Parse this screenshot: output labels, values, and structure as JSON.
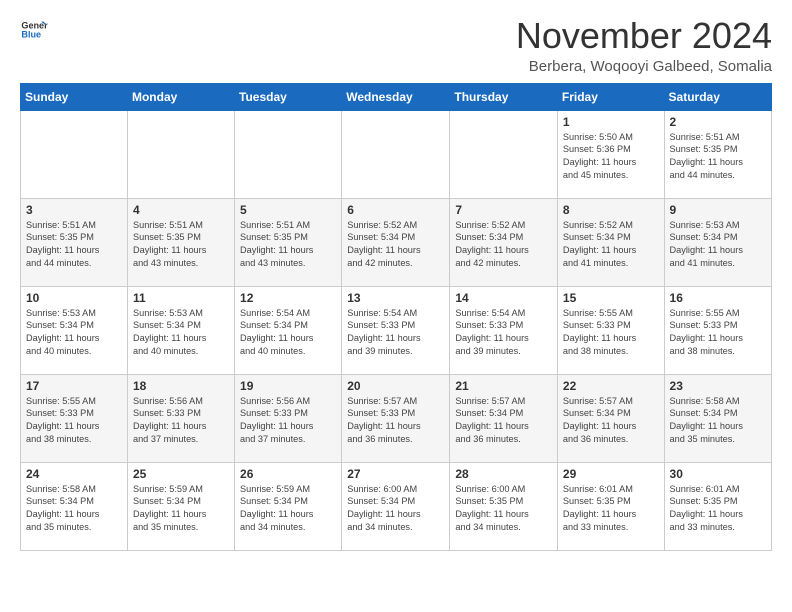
{
  "header": {
    "logo_line1": "General",
    "logo_line2": "Blue",
    "month_title": "November 2024",
    "subtitle": "Berbera, Woqooyi Galbeed, Somalia"
  },
  "days_of_week": [
    "Sunday",
    "Monday",
    "Tuesday",
    "Wednesday",
    "Thursday",
    "Friday",
    "Saturday"
  ],
  "weeks": [
    [
      {
        "num": "",
        "info": ""
      },
      {
        "num": "",
        "info": ""
      },
      {
        "num": "",
        "info": ""
      },
      {
        "num": "",
        "info": ""
      },
      {
        "num": "",
        "info": ""
      },
      {
        "num": "1",
        "info": "Sunrise: 5:50 AM\nSunset: 5:36 PM\nDaylight: 11 hours\nand 45 minutes."
      },
      {
        "num": "2",
        "info": "Sunrise: 5:51 AM\nSunset: 5:35 PM\nDaylight: 11 hours\nand 44 minutes."
      }
    ],
    [
      {
        "num": "3",
        "info": "Sunrise: 5:51 AM\nSunset: 5:35 PM\nDaylight: 11 hours\nand 44 minutes."
      },
      {
        "num": "4",
        "info": "Sunrise: 5:51 AM\nSunset: 5:35 PM\nDaylight: 11 hours\nand 43 minutes."
      },
      {
        "num": "5",
        "info": "Sunrise: 5:51 AM\nSunset: 5:35 PM\nDaylight: 11 hours\nand 43 minutes."
      },
      {
        "num": "6",
        "info": "Sunrise: 5:52 AM\nSunset: 5:34 PM\nDaylight: 11 hours\nand 42 minutes."
      },
      {
        "num": "7",
        "info": "Sunrise: 5:52 AM\nSunset: 5:34 PM\nDaylight: 11 hours\nand 42 minutes."
      },
      {
        "num": "8",
        "info": "Sunrise: 5:52 AM\nSunset: 5:34 PM\nDaylight: 11 hours\nand 41 minutes."
      },
      {
        "num": "9",
        "info": "Sunrise: 5:53 AM\nSunset: 5:34 PM\nDaylight: 11 hours\nand 41 minutes."
      }
    ],
    [
      {
        "num": "10",
        "info": "Sunrise: 5:53 AM\nSunset: 5:34 PM\nDaylight: 11 hours\nand 40 minutes."
      },
      {
        "num": "11",
        "info": "Sunrise: 5:53 AM\nSunset: 5:34 PM\nDaylight: 11 hours\nand 40 minutes."
      },
      {
        "num": "12",
        "info": "Sunrise: 5:54 AM\nSunset: 5:34 PM\nDaylight: 11 hours\nand 40 minutes."
      },
      {
        "num": "13",
        "info": "Sunrise: 5:54 AM\nSunset: 5:33 PM\nDaylight: 11 hours\nand 39 minutes."
      },
      {
        "num": "14",
        "info": "Sunrise: 5:54 AM\nSunset: 5:33 PM\nDaylight: 11 hours\nand 39 minutes."
      },
      {
        "num": "15",
        "info": "Sunrise: 5:55 AM\nSunset: 5:33 PM\nDaylight: 11 hours\nand 38 minutes."
      },
      {
        "num": "16",
        "info": "Sunrise: 5:55 AM\nSunset: 5:33 PM\nDaylight: 11 hours\nand 38 minutes."
      }
    ],
    [
      {
        "num": "17",
        "info": "Sunrise: 5:55 AM\nSunset: 5:33 PM\nDaylight: 11 hours\nand 38 minutes."
      },
      {
        "num": "18",
        "info": "Sunrise: 5:56 AM\nSunset: 5:33 PM\nDaylight: 11 hours\nand 37 minutes."
      },
      {
        "num": "19",
        "info": "Sunrise: 5:56 AM\nSunset: 5:33 PM\nDaylight: 11 hours\nand 37 minutes."
      },
      {
        "num": "20",
        "info": "Sunrise: 5:57 AM\nSunset: 5:33 PM\nDaylight: 11 hours\nand 36 minutes."
      },
      {
        "num": "21",
        "info": "Sunrise: 5:57 AM\nSunset: 5:34 PM\nDaylight: 11 hours\nand 36 minutes."
      },
      {
        "num": "22",
        "info": "Sunrise: 5:57 AM\nSunset: 5:34 PM\nDaylight: 11 hours\nand 36 minutes."
      },
      {
        "num": "23",
        "info": "Sunrise: 5:58 AM\nSunset: 5:34 PM\nDaylight: 11 hours\nand 35 minutes."
      }
    ],
    [
      {
        "num": "24",
        "info": "Sunrise: 5:58 AM\nSunset: 5:34 PM\nDaylight: 11 hours\nand 35 minutes."
      },
      {
        "num": "25",
        "info": "Sunrise: 5:59 AM\nSunset: 5:34 PM\nDaylight: 11 hours\nand 35 minutes."
      },
      {
        "num": "26",
        "info": "Sunrise: 5:59 AM\nSunset: 5:34 PM\nDaylight: 11 hours\nand 34 minutes."
      },
      {
        "num": "27",
        "info": "Sunrise: 6:00 AM\nSunset: 5:34 PM\nDaylight: 11 hours\nand 34 minutes."
      },
      {
        "num": "28",
        "info": "Sunrise: 6:00 AM\nSunset: 5:35 PM\nDaylight: 11 hours\nand 34 minutes."
      },
      {
        "num": "29",
        "info": "Sunrise: 6:01 AM\nSunset: 5:35 PM\nDaylight: 11 hours\nand 33 minutes."
      },
      {
        "num": "30",
        "info": "Sunrise: 6:01 AM\nSunset: 5:35 PM\nDaylight: 11 hours\nand 33 minutes."
      }
    ]
  ]
}
